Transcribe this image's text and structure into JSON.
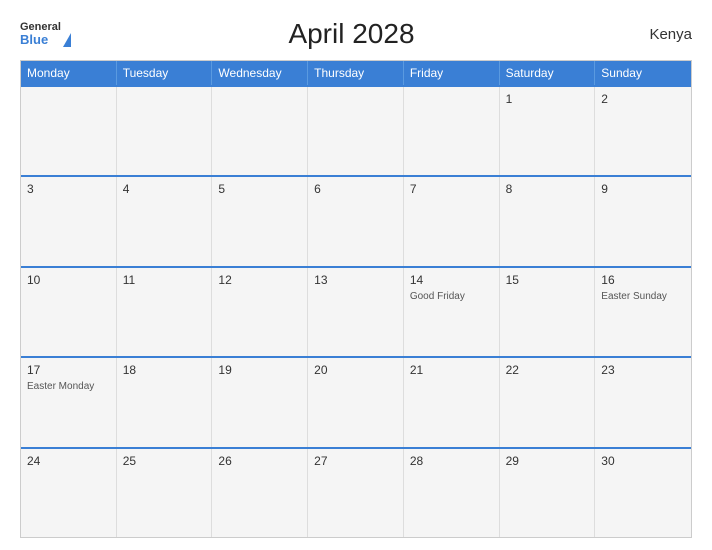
{
  "header": {
    "title": "April 2028",
    "country": "Kenya",
    "logo": {
      "general": "General",
      "blue": "Blue"
    }
  },
  "days_of_week": [
    "Monday",
    "Tuesday",
    "Wednesday",
    "Thursday",
    "Friday",
    "Saturday",
    "Sunday"
  ],
  "weeks": [
    [
      {
        "day": "",
        "event": ""
      },
      {
        "day": "",
        "event": ""
      },
      {
        "day": "",
        "event": ""
      },
      {
        "day": "",
        "event": ""
      },
      {
        "day": "",
        "event": ""
      },
      {
        "day": "1",
        "event": ""
      },
      {
        "day": "2",
        "event": ""
      }
    ],
    [
      {
        "day": "3",
        "event": ""
      },
      {
        "day": "4",
        "event": ""
      },
      {
        "day": "5",
        "event": ""
      },
      {
        "day": "6",
        "event": ""
      },
      {
        "day": "7",
        "event": ""
      },
      {
        "day": "8",
        "event": ""
      },
      {
        "day": "9",
        "event": ""
      }
    ],
    [
      {
        "day": "10",
        "event": ""
      },
      {
        "day": "11",
        "event": ""
      },
      {
        "day": "12",
        "event": ""
      },
      {
        "day": "13",
        "event": ""
      },
      {
        "day": "14",
        "event": "Good Friday"
      },
      {
        "day": "15",
        "event": ""
      },
      {
        "day": "16",
        "event": "Easter Sunday"
      }
    ],
    [
      {
        "day": "17",
        "event": "Easter Monday"
      },
      {
        "day": "18",
        "event": ""
      },
      {
        "day": "19",
        "event": ""
      },
      {
        "day": "20",
        "event": ""
      },
      {
        "day": "21",
        "event": ""
      },
      {
        "day": "22",
        "event": ""
      },
      {
        "day": "23",
        "event": ""
      }
    ],
    [
      {
        "day": "24",
        "event": ""
      },
      {
        "day": "25",
        "event": ""
      },
      {
        "day": "26",
        "event": ""
      },
      {
        "day": "27",
        "event": ""
      },
      {
        "day": "28",
        "event": ""
      },
      {
        "day": "29",
        "event": ""
      },
      {
        "day": "30",
        "event": ""
      }
    ]
  ]
}
